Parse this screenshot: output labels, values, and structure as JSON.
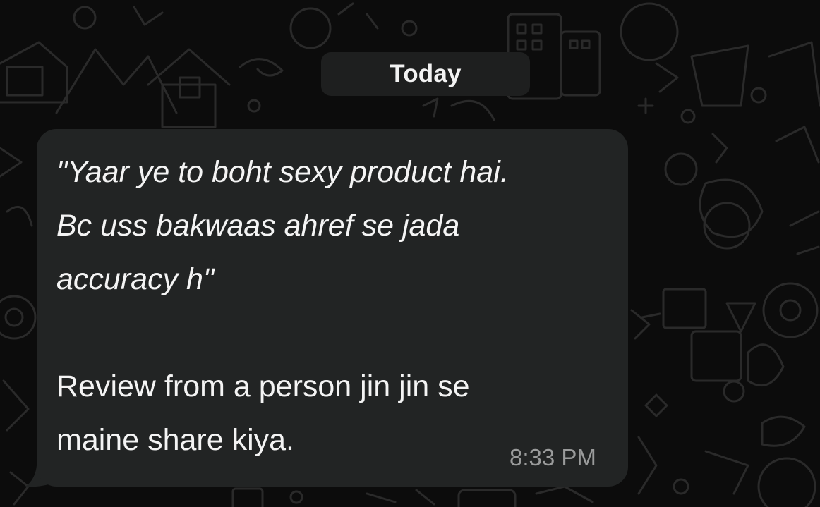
{
  "date_separator": {
    "label": "Today"
  },
  "message": {
    "direction": "incoming",
    "italic_lines": [
      "\"Yaar ye to boht sexy product hai.",
      "Bc uss bakwaas ahref se jada",
      "accuracy h\""
    ],
    "plain_lines": [
      "Review from a person jin jin se",
      "maine share kiya."
    ],
    "time": "8:33 PM"
  },
  "colors": {
    "chat_background": "#0c0c0c",
    "doodle_stroke": "#2a2a2a",
    "bubble_background": "#222424",
    "date_chip_background": "#1e1f1f",
    "message_text": "#f4f4f4",
    "timestamp_text": "#9a9b9b"
  },
  "icons": {
    "background_pattern": "chat-doodle-wallpaper",
    "bubble_tail": "incoming-bubble-tail"
  }
}
